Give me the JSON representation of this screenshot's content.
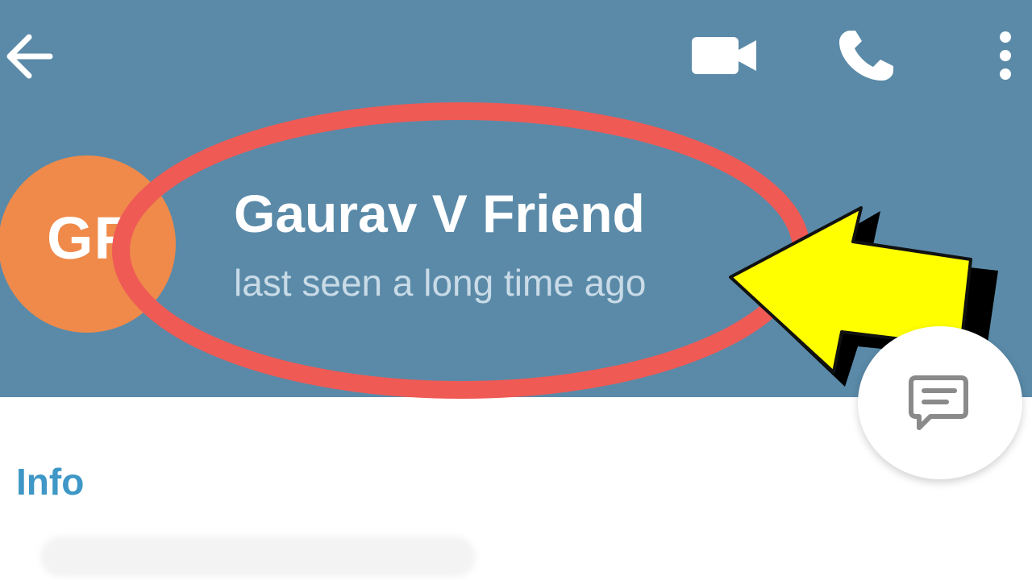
{
  "toolbar": {
    "back_icon": "arrow-left-icon",
    "video_icon": "video-camera-icon",
    "call_icon": "phone-icon",
    "more_icon": "more-vertical-icon"
  },
  "profile": {
    "avatar_initials": "GF",
    "name": "Gaurav V Friend",
    "status": "last seen a long time ago"
  },
  "fab": {
    "icon": "message-icon"
  },
  "section": {
    "info_label": "Info"
  },
  "colors": {
    "header_bg": "#5a8aa8",
    "avatar_bg": "#ef8a4a",
    "highlight_ellipse": "#ef5a55",
    "arrow_fill": "#ffff00",
    "info_accent": "#3e97c6"
  }
}
